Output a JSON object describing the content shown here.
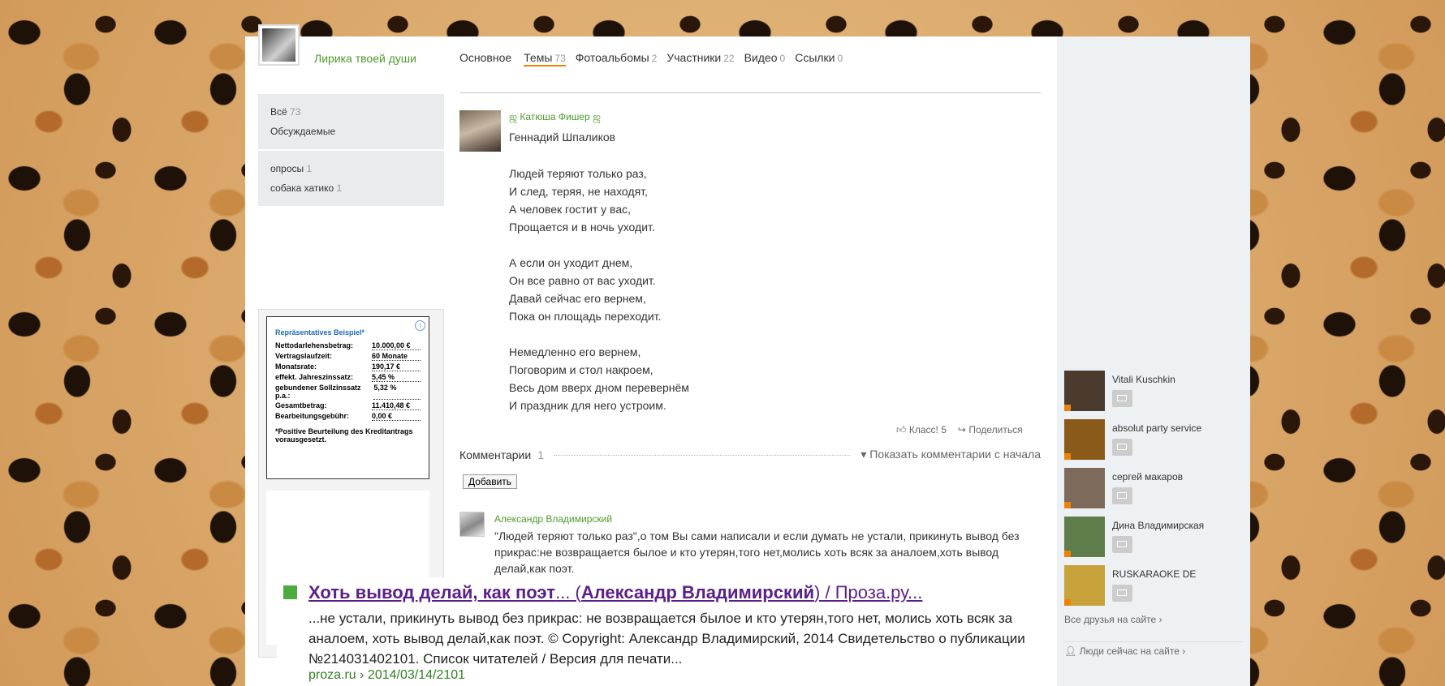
{
  "group": {
    "name": "Лирика твоей души"
  },
  "tabs": [
    {
      "label": "Основное",
      "count": ""
    },
    {
      "label": "Темы",
      "count": "73"
    },
    {
      "label": "Фотоальбомы",
      "count": "2"
    },
    {
      "label": "Участники",
      "count": "22"
    },
    {
      "label": "Видео",
      "count": "0"
    },
    {
      "label": "Ссылки",
      "count": "0"
    }
  ],
  "leftnav": {
    "group1": [
      {
        "label": "Всё",
        "count": "73"
      },
      {
        "label": "Обсуждаемые",
        "count": ""
      }
    ],
    "group2": [
      {
        "label": "опросы",
        "count": "1"
      },
      {
        "label": "собака хатико",
        "count": "1"
      }
    ]
  },
  "ad": {
    "title": "Repräsentatives Beispiel*",
    "rows": [
      {
        "k": "Nettodarlehensbetrag:",
        "v": "10.000,00 €"
      },
      {
        "k": "Vertragslaufzeit:",
        "v": "60 Monate"
      },
      {
        "k": "Monatsrate:",
        "v": "190,17 €"
      },
      {
        "k": "effekt. Jahreszinssatz:",
        "v": "5,45 %"
      },
      {
        "k": "gebundener Sollzinssatz p.a.:",
        "v": "5,32 %"
      },
      {
        "k": "Gesamtbetrag:",
        "v": "11.410,48 €"
      },
      {
        "k": "Bearbeitungsgebühr:",
        "v": "0,00 €"
      }
    ],
    "note": "*Positive Beurteilung des Kreditantrags vorausgesetzt.",
    "info": "i"
  },
  "post": {
    "author": "ஜ Катюша Фишер ஜ",
    "title": "Геннадий Шпаликов",
    "stanzas": [
      [
        "Людей теряют только раз,",
        "И след, теряя, не находят,",
        "А человек гостит у вас,",
        "Прощается и в ночь уходит."
      ],
      [
        "А если он уходит днем,",
        "Он все равно от вас уходит.",
        "Давай сейчас его вернем,",
        "Пока он площадь переходит."
      ],
      [
        "Немедленно его вернем,",
        "Поговорим и стол накроем,",
        "Весь дом вверх дном перевернём",
        "И праздник для него устроим."
      ]
    ],
    "like_label": "Класс! 5",
    "share_label": "Поделиться"
  },
  "comments": {
    "label": "Комментарии",
    "count": "1",
    "show_from_start": "▾ Показать комментарии с начала",
    "add_button": "Добавить",
    "items": [
      {
        "author": "Александр Владимирский",
        "text": "\"Людей теряют только раз\",о том Вы сами написали и если думать не устали, прикинуть вывод без прикрас:не возвращается былое и кто утерян,того нет,молись хоть всяк за аналоем,хоть вывод делай,как поэт."
      }
    ]
  },
  "overlay": {
    "title_a": "Хоть вывод делай, как поэт",
    "title_b": "... (",
    "title_c": "Александр Владимирский",
    "title_d": ") / Проза.ру...",
    "snippet": "...не устали, прикинуть вывод без прикрас: не возвращается былое и кто утерян,того нет, молись хоть всяк за аналоем, хоть вывод делай,как поэт. © Copyright: Александр Владимирский, 2014 Свидетельство о публикации №214031402101. Список читателей / Версия для печати...",
    "url": "proza.ru › 2014/03/14/2101",
    "accent": "#4caa3f"
  },
  "friends": [
    {
      "name": "Vitali Kuschkin",
      "color": "#4a3b2e"
    },
    {
      "name": "absolut party service",
      "color": "#8a5a1a"
    },
    {
      "name": "сергей макаров",
      "color": "#7d6a5a"
    },
    {
      "name": "Дина Владимирская",
      "color": "#5f7d4a"
    },
    {
      "name": "RUSKARAOKE DE",
      "color": "#c8a23a"
    }
  ],
  "all_friends": "Все друзья на сайте ›",
  "people_now": "Люди сейчас на сайте ›",
  "colors": {
    "brand_green": "#4e9a2a",
    "accent_orange": "#ee8208"
  }
}
